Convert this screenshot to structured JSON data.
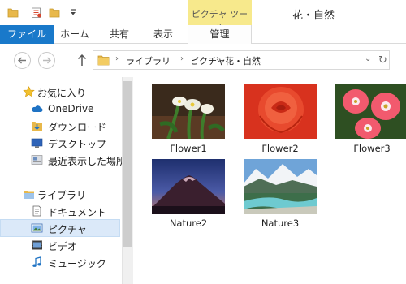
{
  "window": {
    "title": "花・自然"
  },
  "context_tab": {
    "title": "ピクチャ ツール",
    "tab_label": "管理"
  },
  "ribbon": {
    "tabs": [
      "ファイル",
      "ホーム",
      "共有",
      "表示"
    ]
  },
  "address": {
    "crumbs": [
      "ライブラリ",
      "ピクチャ",
      "花・自然"
    ]
  },
  "nav": {
    "favorites": {
      "label": "お気に入り"
    },
    "items": [
      "OneDrive",
      "ダウンロード",
      "デスクトップ",
      "最近表示した場所"
    ],
    "libraries": {
      "label": "ライブラリ"
    },
    "library_items": [
      "ドキュメント",
      "ピクチャ",
      "ビデオ",
      "ミュージック"
    ]
  },
  "files": [
    {
      "name": "Flower1",
      "subject": "white-flowers"
    },
    {
      "name": "Flower2",
      "subject": "red-rose"
    },
    {
      "name": "Flower3",
      "subject": "pink-gerbera"
    },
    {
      "name": "Nature2",
      "subject": "mountain-sunrise"
    },
    {
      "name": "Nature3",
      "subject": "alpine-river"
    }
  ],
  "colors": {
    "accent": "#1979ca",
    "context_tab": "#f7e98c",
    "selection": "#dbe9f9"
  }
}
